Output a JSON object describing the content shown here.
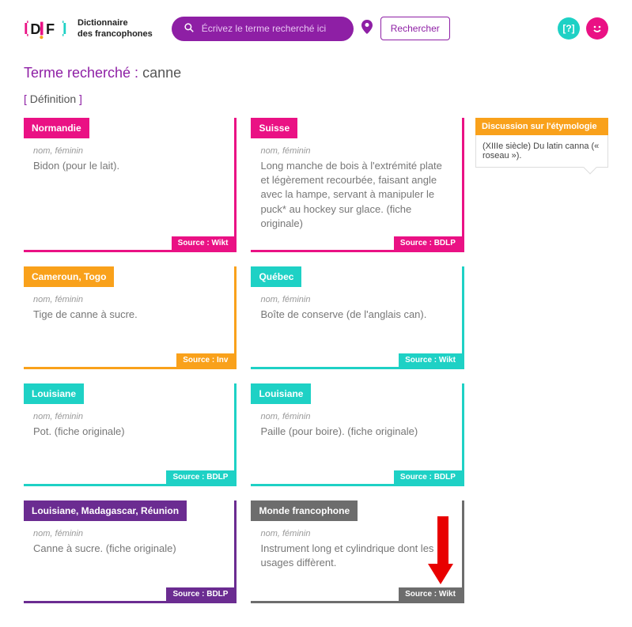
{
  "header": {
    "site_name_line1": "Dictionnaire",
    "site_name_line2": "des francophones",
    "search_placeholder": "Écrivez le terme recherché ici",
    "search_button": "Rechercher",
    "help_label": "[?]",
    "smile_label": "☺"
  },
  "term": {
    "prefix": "Terme recherché : ",
    "value": "canne"
  },
  "section": {
    "open": "[ ",
    "label": "Définition",
    "close": " ]"
  },
  "cards": [
    {
      "region": "Normandie",
      "meta": "nom, féminin",
      "definition": "Bidon (pour le lait).",
      "source": "Source : Wikt",
      "color": "pink"
    },
    {
      "region": "Suisse",
      "meta": "nom, féminin",
      "definition": "Long manche de bois à l'extrémité plate et légèrement recourbée, faisant angle avec la hampe, servant à manipuler le puck* au hockey sur glace. (fiche originale)",
      "source": "Source : BDLP",
      "color": "pink"
    },
    {
      "region": "Cameroun, Togo",
      "meta": "nom, féminin",
      "definition": "Tige de canne à sucre.",
      "source": "Source : Inv",
      "color": "orange"
    },
    {
      "region": "Québec",
      "meta": "nom, féminin",
      "definition": "Boîte de conserve (de l'anglais can).",
      "source": "Source : Wikt",
      "color": "teal"
    },
    {
      "region": "Louisiane",
      "meta": "nom, féminin",
      "definition": "Pot. (fiche originale)",
      "source": "Source : BDLP",
      "color": "teal"
    },
    {
      "region": "Louisiane",
      "meta": "nom, féminin",
      "definition": "Paille (pour boire). (fiche originale)",
      "source": "Source : BDLP",
      "color": "teal"
    },
    {
      "region": "Louisiane, Madagascar, Réunion",
      "meta": "nom, féminin",
      "definition": "Canne à sucre. (fiche originale)",
      "source": "Source : BDLP",
      "color": "purple"
    },
    {
      "region": "Monde francophone",
      "meta": "nom, féminin",
      "definition": "Instrument long et cylindrique dont les usages diffèrent.",
      "source": "Source : Wikt",
      "color": "grey"
    }
  ],
  "sidebar": {
    "title": "Discussion sur l'étymologie",
    "text": "(XIIIe siècle) Du latin canna (« roseau »)."
  }
}
